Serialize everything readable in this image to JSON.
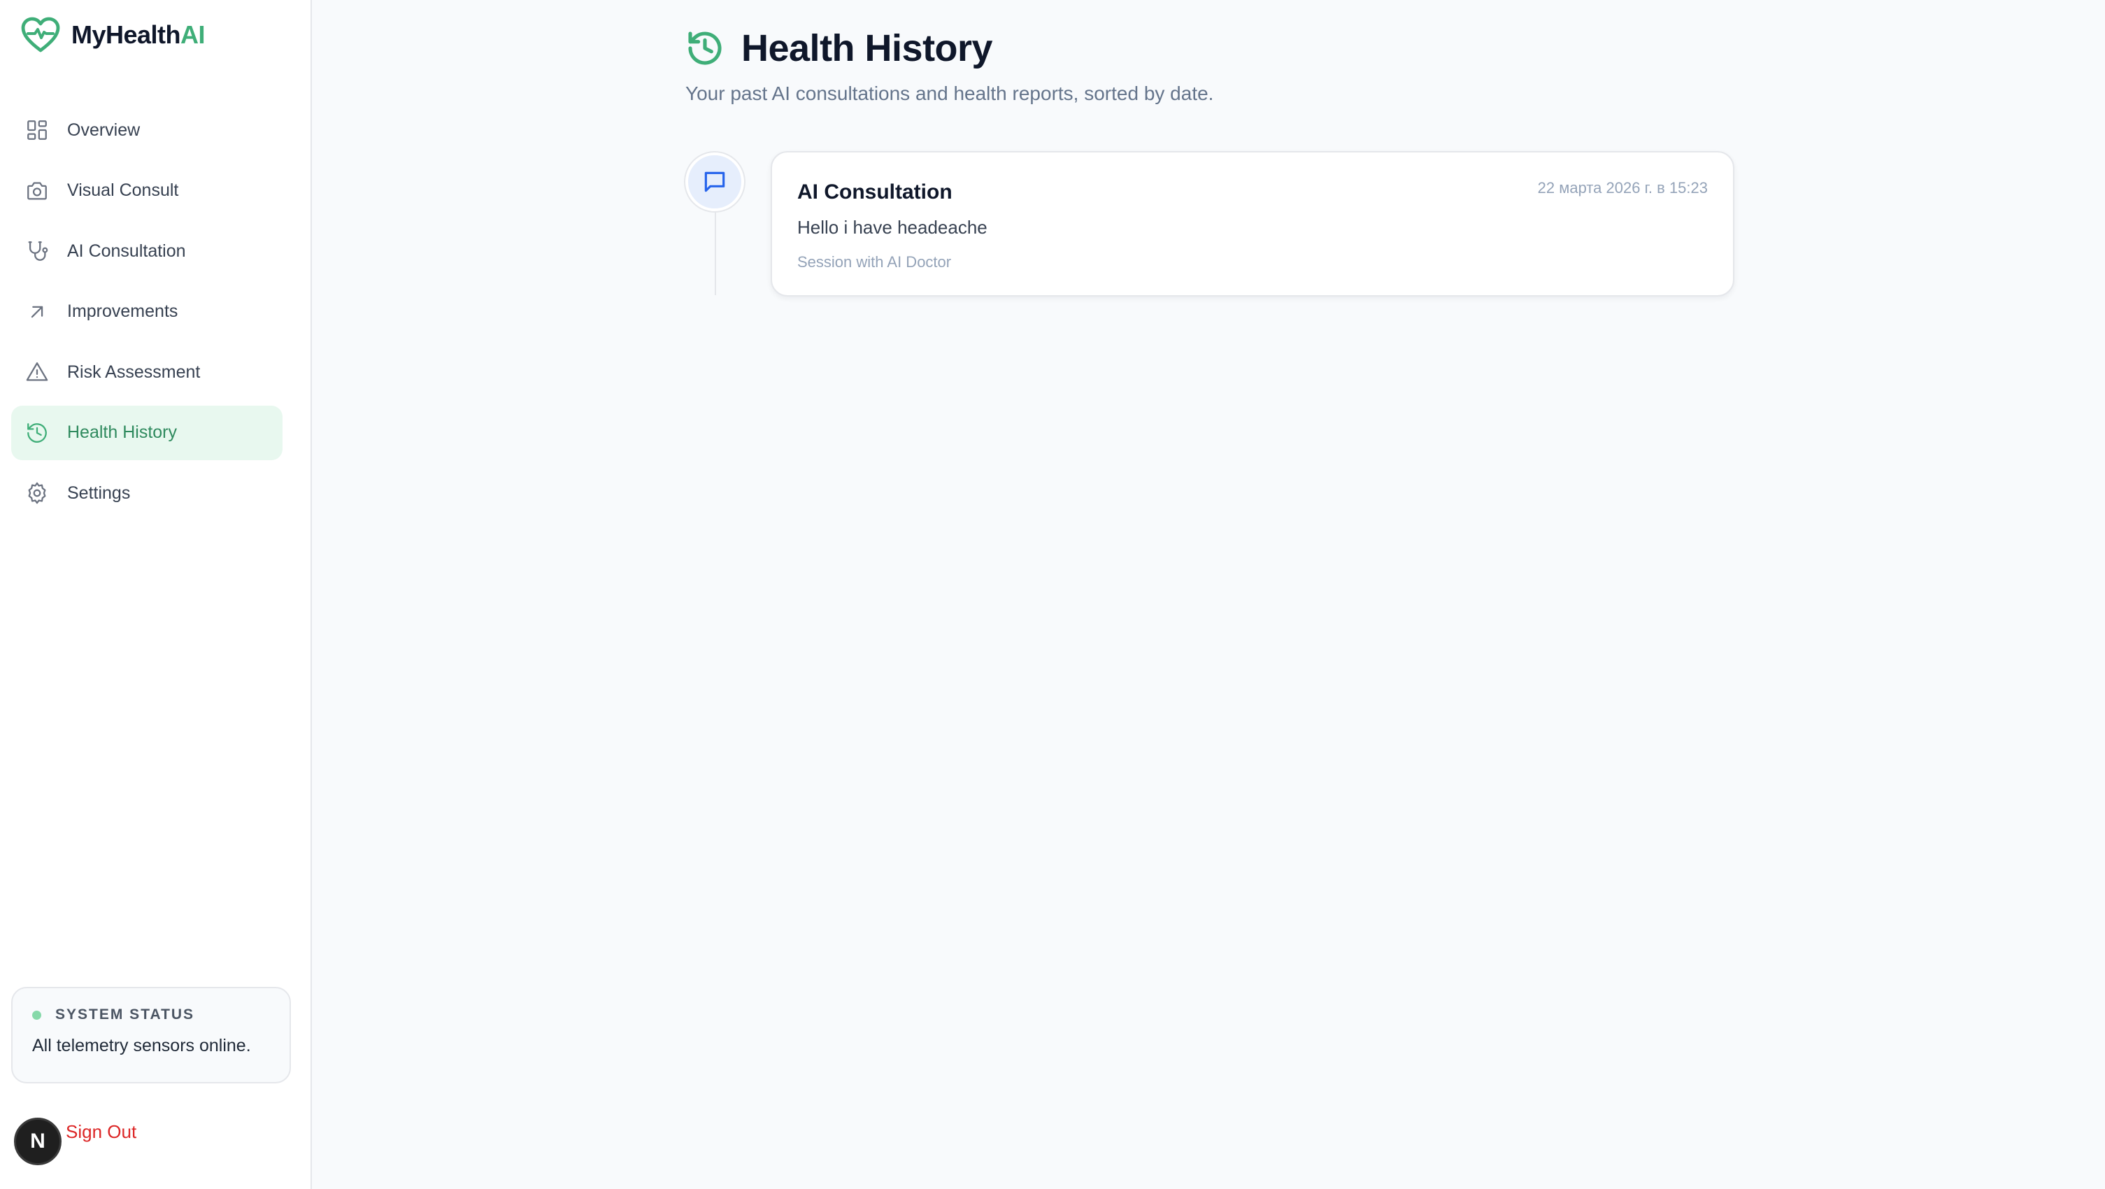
{
  "app": {
    "name_main": "MyHealth",
    "name_accent": "AI",
    "brand_color": "#3fae78"
  },
  "sidebar": {
    "items": [
      {
        "label": "Overview",
        "icon": "grid-icon",
        "active": false
      },
      {
        "label": "Visual Consult",
        "icon": "camera-icon",
        "active": false
      },
      {
        "label": "AI Consultation",
        "icon": "stethoscope-icon",
        "active": false
      },
      {
        "label": "Improvements",
        "icon": "arrow-up-right-icon",
        "active": false
      },
      {
        "label": "Risk Assessment",
        "icon": "warning-triangle-icon",
        "active": false
      },
      {
        "label": "Health History",
        "icon": "history-icon",
        "active": true
      },
      {
        "label": "Settings",
        "icon": "gear-icon",
        "active": false
      }
    ],
    "status": {
      "title": "SYSTEM STATUS",
      "message": "All telemetry sensors online.",
      "dot_color": "#86d9a9"
    },
    "signout": {
      "avatar_letter": "N",
      "label": "Sign Out"
    }
  },
  "main": {
    "title": "Health History",
    "subtitle": "Your past AI consultations and health reports, sorted by date.",
    "entries": [
      {
        "icon": "message-icon",
        "title": "AI Consultation",
        "date": "22 марта 2026 г. в 15:23",
        "text": "Hello i have headeache",
        "meta": "Session with AI Doctor"
      }
    ]
  }
}
